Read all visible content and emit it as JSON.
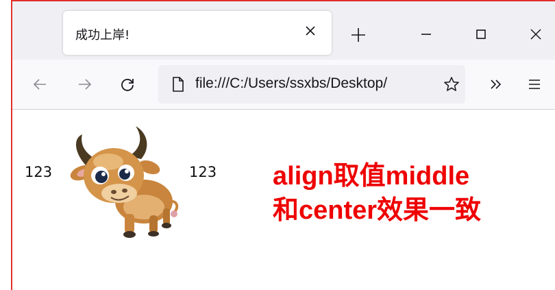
{
  "browser": {
    "tab": {
      "title": "成功上岸!",
      "close_icon": "close-icon"
    },
    "new_tab_icon": "plus-icon",
    "window_controls": [
      "minimize-icon",
      "maximize-icon",
      "close-icon"
    ],
    "nav": {
      "back_icon": "back-arrow-icon",
      "forward_icon": "forward-arrow-icon",
      "reload_icon": "reload-icon",
      "page_icon": "page-icon",
      "url": "file:///C:/Users/ssxbs/Desktop/",
      "bookmark_icon": "star-icon",
      "overflow_icon": "chevron-double-right-icon",
      "menu_icon": "hamburger-menu-icon"
    }
  },
  "content": {
    "text_before": "123",
    "text_after": "123",
    "image_subject": "cartoon-ox",
    "caption_line1": "align取值middle",
    "caption_line2": "和center效果一致"
  },
  "colors": {
    "annotation_red": "#ee0000",
    "frame_red": "#e0302a",
    "tabstrip_bg": "#f0f0f4",
    "navbar_bg": "#f9f9fb"
  }
}
